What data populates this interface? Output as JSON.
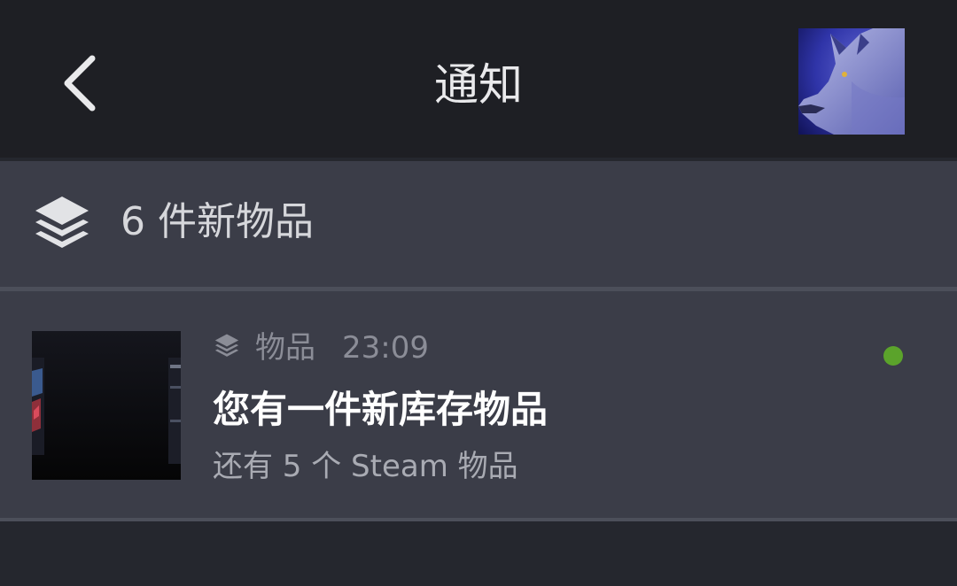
{
  "header": {
    "title": "通知",
    "back_icon": "chevron-left-icon",
    "avatar": "user-avatar-wolf"
  },
  "summary": {
    "icon": "stacked-layers-icon",
    "text": "6 件新物品"
  },
  "notification": {
    "type_icon": "stacked-layers-icon",
    "type_label": "物品",
    "time": "23:09",
    "title": "您有一件新库存物品",
    "subtitle": "还有 5 个 Steam 物品",
    "unread": true,
    "unread_color": "#5ba32b"
  },
  "colors": {
    "header_bg": "#1e1f24",
    "panel_bg": "#3b3d48",
    "page_bg": "#25272e"
  }
}
